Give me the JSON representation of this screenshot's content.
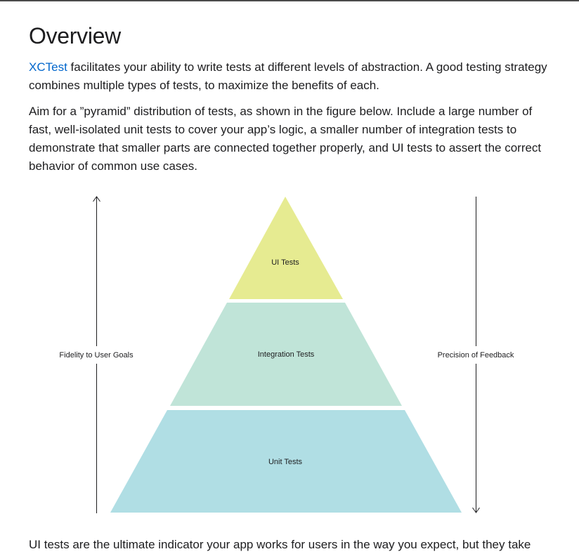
{
  "heading": "Overview",
  "intro": {
    "link_text": "XCTest",
    "text_after_link": " facilitates your ability to write tests at different levels of abstraction. A good testing strategy combines multiple types of tests, to maximize the benefits of each."
  },
  "paragraph2": "Aim for a ”pyramid” distribution of tests, as shown in the figure below. Include a large number of fast, well-isolated unit tests to cover your app’s logic, a smaller number of integration tests to demonstrate that smaller parts are connected together properly, and UI tests to assert the correct behavior of common use cases.",
  "figure": {
    "left_axis_label": "Fidelity to User Goals",
    "right_axis_label": "Precision of Feedback",
    "tiers": {
      "top": {
        "label": "UI Tests",
        "color": "#e6eb91"
      },
      "middle": {
        "label": "Integration Tests",
        "color": "#c0e4d8"
      },
      "bottom": {
        "label": "Unit Tests",
        "color": "#b0dee4"
      }
    }
  },
  "paragraph3": "UI tests are the ultimate indicator your app works for users in the way you expect, but they take"
}
